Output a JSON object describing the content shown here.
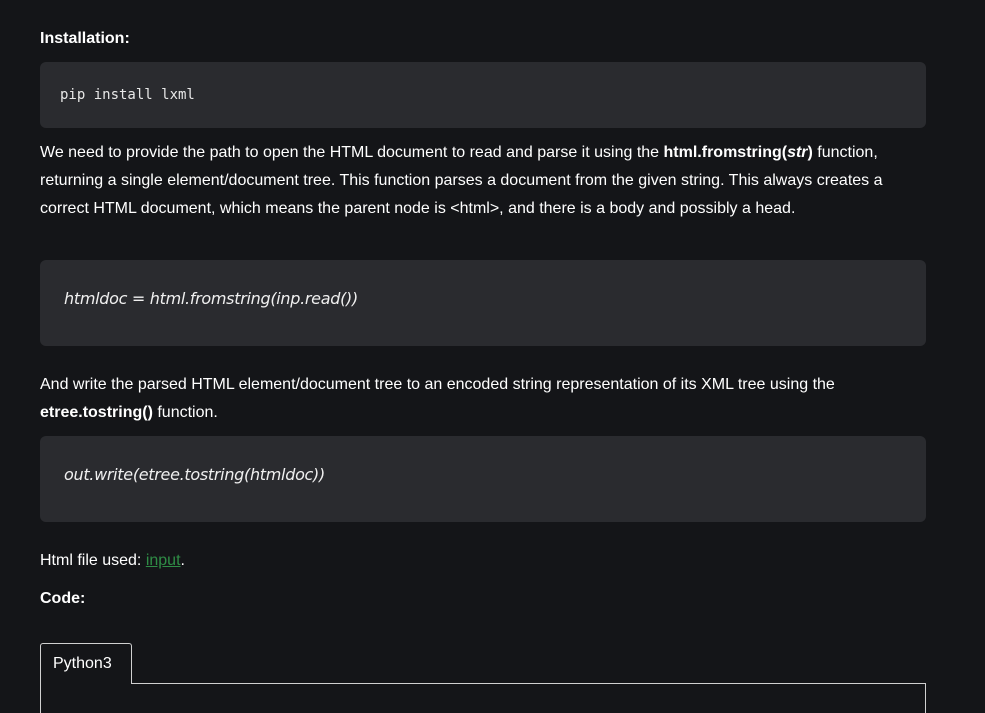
{
  "installation": {
    "heading": "Installation:",
    "command": "pip install lxml"
  },
  "paragraph1": {
    "text_before": "We need to provide the path to open the HTML document to read and parse it using the ",
    "func_name": "html.fromstring(",
    "func_arg": "str",
    "func_close": ")",
    "line2": " function, returning a single element/document tree. This function parses a document from the given string. This always creates a correct HTML document, which means the parent node is <html>, and there is a body and possibly a head."
  },
  "code1": "htmldoc = html.fromstring(inp.read())",
  "paragraph2": {
    "text_before": "And write the parsed HTML element/document tree to an encoded string representation of its XML tree using the ",
    "func_name": "etree.tostring()",
    "text_after": " function."
  },
  "code2": "out.write(etree.tostring(htmldoc))",
  "html_file": {
    "label": "Html file used: ",
    "link_text": "input",
    "suffix": "."
  },
  "code_heading": "Code:",
  "tabs": [
    {
      "label": "Python3"
    }
  ],
  "colors": {
    "background": "#141518",
    "code_block": "#2a2b2f",
    "link": "#2f8d46"
  }
}
